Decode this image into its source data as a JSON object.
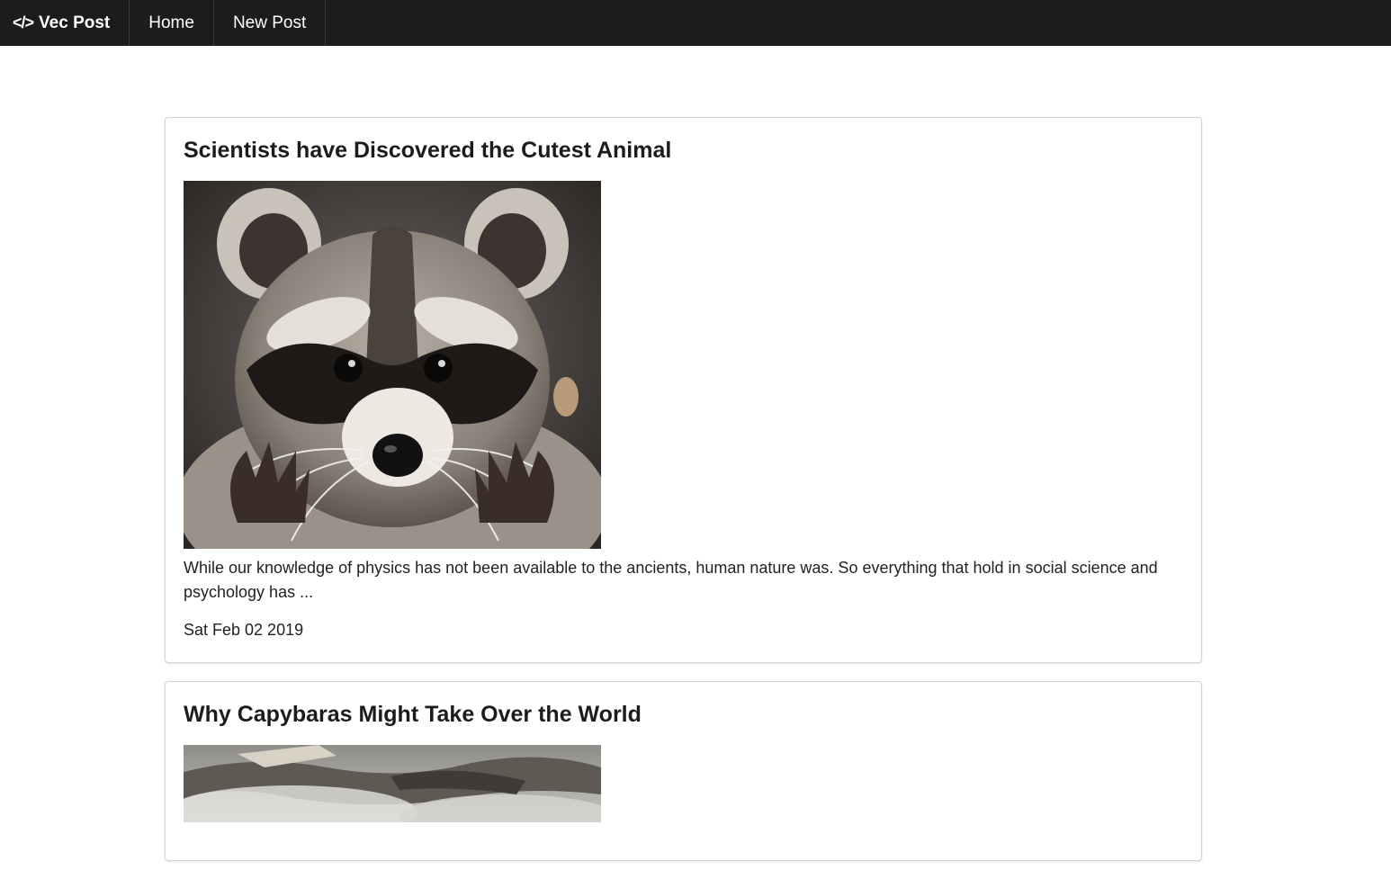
{
  "nav": {
    "brand": "Vec Post",
    "brand_icon": "code-icon",
    "items": [
      {
        "label": "Home"
      },
      {
        "label": "New Post"
      }
    ]
  },
  "posts": [
    {
      "title": "Scientists have Discovered the Cutest Animal",
      "image": "raccoon-photo",
      "excerpt": "While our knowledge of physics has not been available to the ancients, human nature was. So everything that hold in social science and psychology has ...",
      "date": "Sat Feb 02 2019"
    },
    {
      "title": "Why Capybaras Might Take Over the World",
      "image": "capybara-photo"
    }
  ],
  "colors": {
    "navbar_bg": "#1b1c1d",
    "nav_text": "#ffffff",
    "card_border": "#d4d4d5"
  }
}
